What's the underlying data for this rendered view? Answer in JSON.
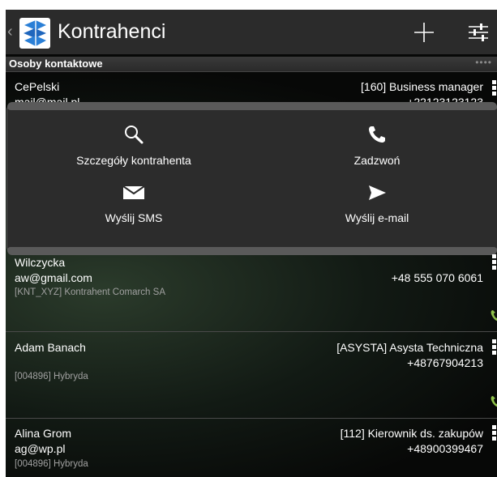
{
  "header": {
    "title": "Kontrahenci",
    "up_icon": "chevron-left-icon",
    "logo_icon": "comarch-logo-icon",
    "add_icon": "plus-icon",
    "filter_icon": "sliders-icon"
  },
  "section": {
    "title": "Osoby kontaktowe",
    "more": "••••"
  },
  "contacts": [
    {
      "name": "CePelski",
      "email": "mail@mail.pl",
      "right1": "[160] Business manager",
      "right2": "+22123123123",
      "code": ""
    },
    {
      "name": "Wilczycka",
      "email": "aw@gmail.com",
      "right1": "",
      "right2": "+48 555 070 6061",
      "code": "[KNT_XYZ] Kontrahent Comarch SA"
    },
    {
      "name": "Adam Banach",
      "email": "",
      "right1": "[ASYSTA] Asysta Techniczna",
      "right2": "+48767904213",
      "code": "[004896] Hybryda"
    },
    {
      "name": "Alina Grom",
      "email": "ag@wp.pl",
      "right1": "[112] Kierownik ds. zakupów",
      "right2": "+48900399467",
      "code": "[004896] Hybryda"
    }
  ],
  "popup": {
    "details": "Szczegóły kontrahenta",
    "call": "Zadzwoń",
    "sms": "Wyślij SMS",
    "email": "Wyślij e-mail"
  },
  "colors": {
    "call_icon": "#8fc14a",
    "logo_blue": "#2a7fd6",
    "bar": "#2b2b2b"
  }
}
